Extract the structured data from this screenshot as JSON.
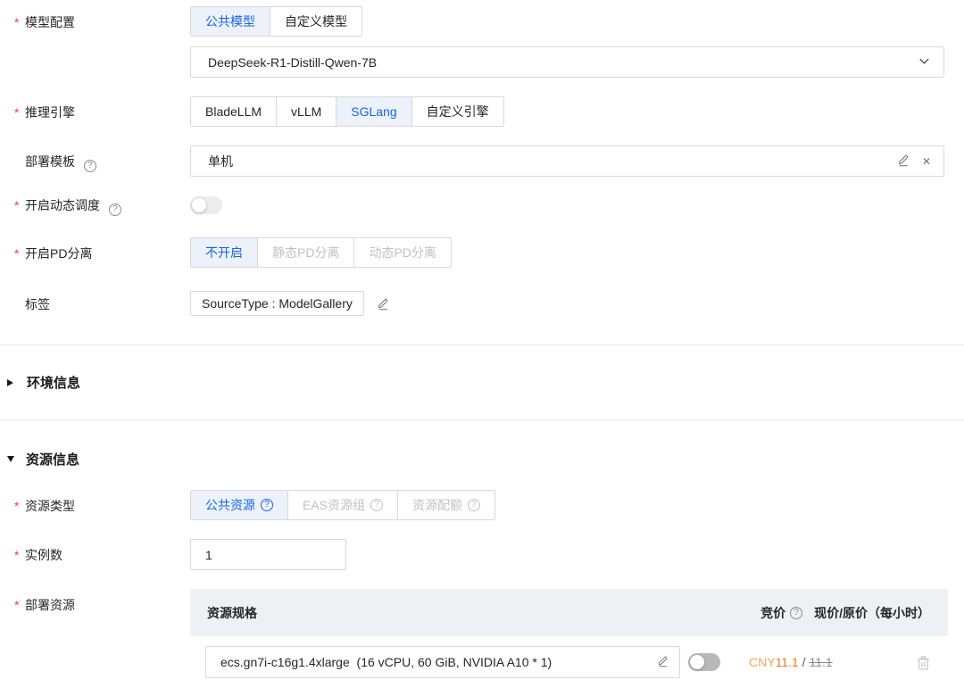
{
  "required_mark": "*",
  "icons": {
    "help": "?",
    "close": "✕"
  },
  "colors": {
    "accent_blue": "#1366ec",
    "required_red": "#e54545",
    "price_current_orange": "#f5761a",
    "price_currency_orange": "#f5a759",
    "table_header_bg": "#eef0f4"
  },
  "form": {
    "model_config": {
      "label": "模型配置",
      "tabs": [
        {
          "label": "公共模型"
        },
        {
          "label": "自定义模型"
        }
      ],
      "selected_tab": "公共模型",
      "selected_model": "DeepSeek-R1-Distill-Qwen-7B"
    },
    "inference_engine": {
      "label": "推理引擎",
      "tabs": [
        {
          "label": "BladeLLM"
        },
        {
          "label": "vLLM"
        },
        {
          "label": "SGLang"
        },
        {
          "label": "自定义引擎"
        }
      ],
      "selected_tab": "SGLang"
    },
    "deploy_template": {
      "label": "部署模板",
      "value": "单机"
    },
    "dynamic_schedule": {
      "label": "开启动态调度",
      "toggle_on": false
    },
    "pd_separation": {
      "label": "开启PD分离",
      "tabs": [
        {
          "label": "不开启"
        },
        {
          "label": "静态PD分离"
        },
        {
          "label": "动态PD分离"
        }
      ],
      "selected_tab": "不开启"
    },
    "tags": {
      "label": "标签",
      "tag_value": "SourceType : ModelGallery"
    }
  },
  "sections": {
    "environment": {
      "title": "环境信息",
      "collapsed": true
    },
    "resource": {
      "title": "资源信息",
      "collapsed": false
    }
  },
  "resource_form": {
    "resource_type": {
      "label": "资源类型",
      "tabs": [
        {
          "label": "公共资源"
        },
        {
          "label": "EAS资源组"
        },
        {
          "label": "资源配额"
        }
      ],
      "selected_tab": "公共资源"
    },
    "instance_count": {
      "label": "实例数",
      "value": "1"
    },
    "deploy_resource": {
      "label": "部署资源",
      "table": {
        "header": {
          "spec": "资源规格",
          "spot": "竞价",
          "price": "现价/原价（每小时）"
        },
        "row": {
          "spec": "ecs.gn7i-c16g1.4xlarge  (16 vCPU, 60 GiB, NVIDIA A10 * 1)",
          "spot_on": false,
          "currency": "CNY",
          "current_price": "11.1",
          "price_divider": " / ",
          "original_price": "11.1"
        }
      }
    }
  }
}
